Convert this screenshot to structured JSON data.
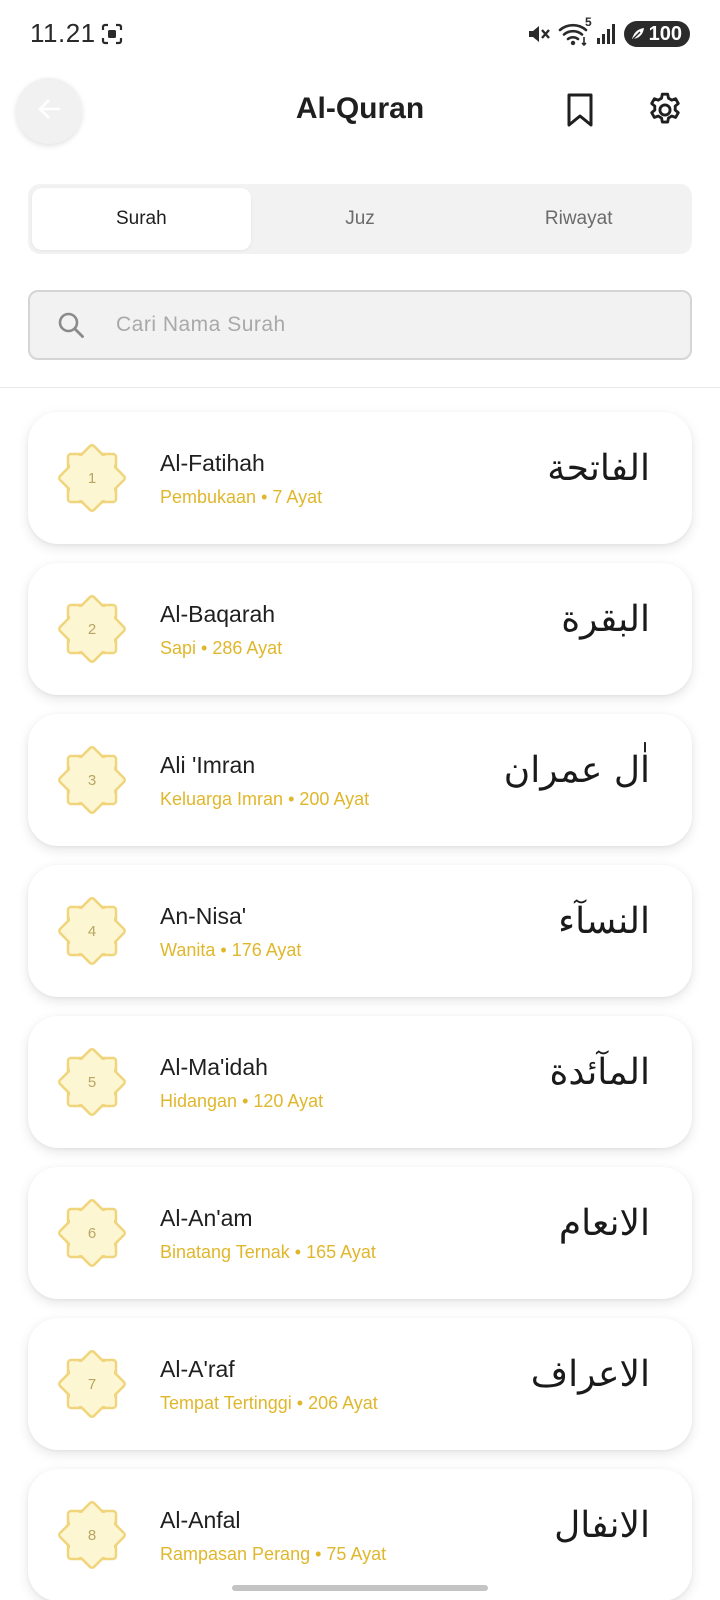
{
  "status_bar": {
    "time": "11.21",
    "battery": "100",
    "network": "5"
  },
  "header": {
    "title": "Al-Quran"
  },
  "tabs": [
    {
      "label": "Surah",
      "active": true
    },
    {
      "label": "Juz",
      "active": false
    },
    {
      "label": "Riwayat",
      "active": false
    }
  ],
  "search": {
    "placeholder": "Cari Nama Surah",
    "value": ""
  },
  "colors": {
    "accent": "#e0b72c",
    "badge_fill": "#fdf6d3",
    "badge_stroke": "#f0d57c"
  },
  "surahs": [
    {
      "number": "1",
      "name": "Al-Fatihah",
      "meaning": "Pembukaan",
      "ayat": "7 Ayat",
      "arabic": "الفاتحة"
    },
    {
      "number": "2",
      "name": "Al-Baqarah",
      "meaning": "Sapi",
      "ayat": "286 Ayat",
      "arabic": "البقرة"
    },
    {
      "number": "3",
      "name": "Ali 'Imran",
      "meaning": "Keluarga Imran",
      "ayat": "200 Ayat",
      "arabic": "اٰل عمران"
    },
    {
      "number": "4",
      "name": "An-Nisa'",
      "meaning": "Wanita",
      "ayat": "176 Ayat",
      "arabic": "النسآء"
    },
    {
      "number": "5",
      "name": "Al-Ma'idah",
      "meaning": "Hidangan",
      "ayat": "120 Ayat",
      "arabic": "المآئدة"
    },
    {
      "number": "6",
      "name": "Al-An'am",
      "meaning": "Binatang Ternak",
      "ayat": "165 Ayat",
      "arabic": "الانعام"
    },
    {
      "number": "7",
      "name": "Al-A'raf",
      "meaning": "Tempat Tertinggi",
      "ayat": "206 Ayat",
      "arabic": "الاعراف"
    },
    {
      "number": "8",
      "name": "Al-Anfal",
      "meaning": "Rampasan Perang",
      "ayat": "75 Ayat",
      "arabic": "الانفال"
    }
  ]
}
